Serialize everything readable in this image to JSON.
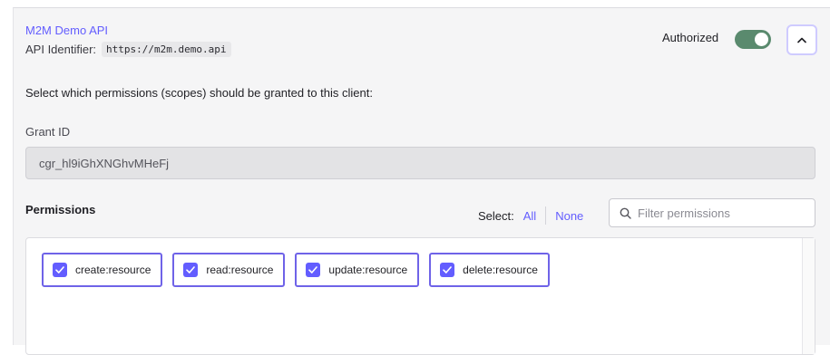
{
  "api": {
    "name": "M2M Demo API",
    "identifier_label": "API Identifier:",
    "identifier_value": "https://m2m.demo.api"
  },
  "authorization": {
    "label": "Authorized",
    "enabled": true,
    "toggle_color": "#5a8a6e"
  },
  "intro_text": "Select which permissions (scopes) should be granted to this client:",
  "grant": {
    "label": "Grant ID",
    "value": "cgr_hl9iGhXNGhvMHeFj"
  },
  "permissions": {
    "label": "Permissions",
    "select_label": "Select:",
    "select_all": "All",
    "select_none": "None",
    "filter_placeholder": "Filter permissions",
    "items": [
      {
        "label": "create:resource",
        "checked": true
      },
      {
        "label": "read:resource",
        "checked": true
      },
      {
        "label": "update:resource",
        "checked": true
      },
      {
        "label": "delete:resource",
        "checked": true
      }
    ]
  },
  "colors": {
    "accent": "#635dff",
    "chip_border": "#6f63e8"
  },
  "icons": {
    "collapse": "chevron-up-icon",
    "filter": "search-icon",
    "check": "check-icon"
  }
}
